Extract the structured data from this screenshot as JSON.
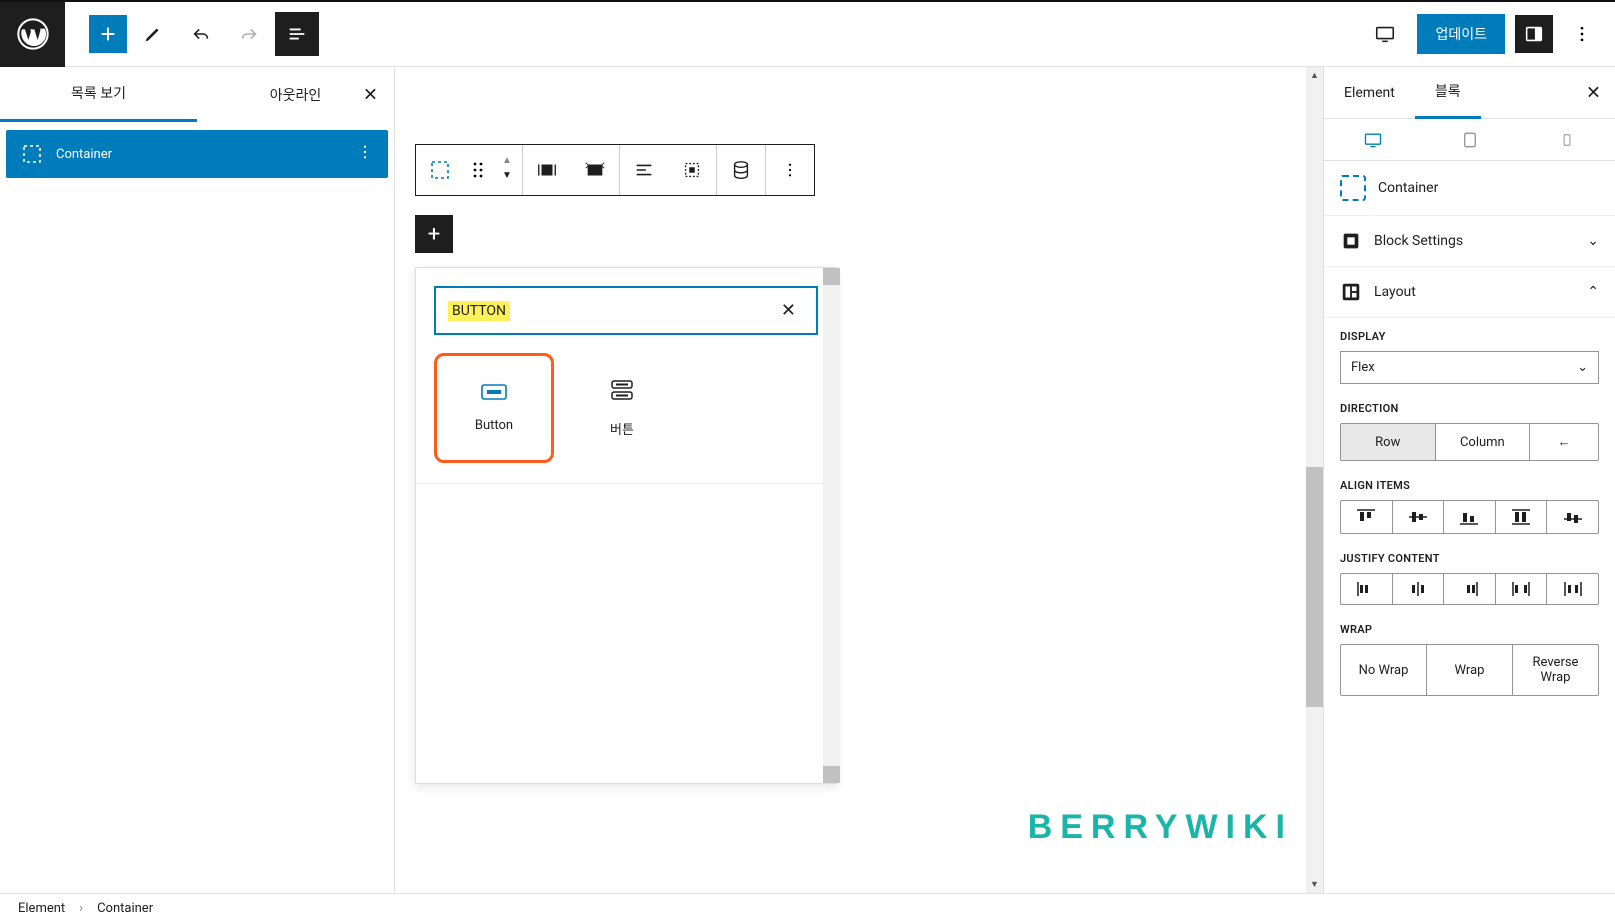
{
  "topbar": {
    "update_label": "업데이트"
  },
  "left_panel": {
    "tabs": {
      "list_view": "목록 보기",
      "outline": "아웃라인"
    },
    "item_label": "Container"
  },
  "inserter": {
    "search_value": "BUTTON",
    "options": [
      {
        "label": "Button"
      },
      {
        "label": "버튼"
      }
    ]
  },
  "right_panel": {
    "tabs": {
      "element": "Element",
      "block": "블록"
    },
    "block_label": "Container",
    "block_settings_label": "Block Settings",
    "layout_label": "Layout",
    "display_label": "DISPLAY",
    "display_value": "Flex",
    "direction_label": "DIRECTION",
    "direction_options": {
      "row": "Row",
      "column": "Column"
    },
    "align_label": "ALIGN ITEMS",
    "justify_label": "JUSTIFY CONTENT",
    "wrap_label": "WRAP",
    "wrap_options": {
      "no_wrap": "No Wrap",
      "wrap": "Wrap",
      "reverse": "Reverse Wrap"
    }
  },
  "breadcrumb": {
    "root": "Element",
    "current": "Container"
  },
  "watermark": "BERRYWIKI"
}
